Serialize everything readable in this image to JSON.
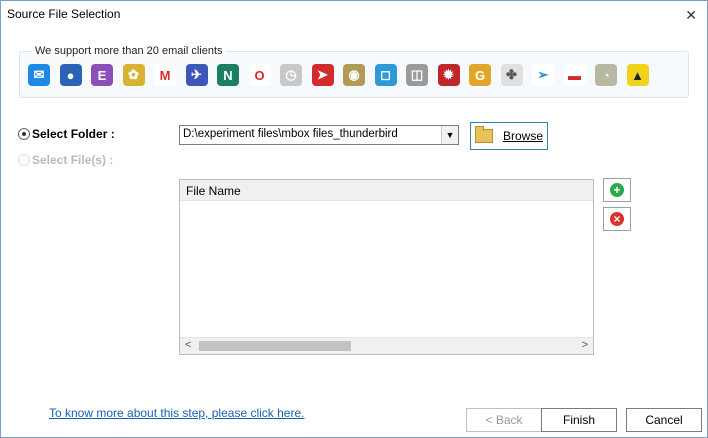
{
  "window": {
    "title": "Source File Selection",
    "close_glyph": "✕"
  },
  "clients": {
    "label": "We support more than 20 email clients",
    "icons": [
      {
        "name": "outlook-icon",
        "bg": "#1e88e5",
        "glyph": "✉"
      },
      {
        "name": "thunderbird-icon",
        "bg": "#2a63b5",
        "glyph": "●"
      },
      {
        "name": "entourage-icon",
        "bg": "#8b4fb8",
        "glyph": "E"
      },
      {
        "name": "eudora-icon",
        "bg": "#d8b232",
        "glyph": "✿"
      },
      {
        "name": "gmail-icon",
        "bg": "#ffffff",
        "glyph": "M",
        "fg": "#d93025"
      },
      {
        "name": "postbox-icon",
        "bg": "#3b57b8",
        "glyph": "✈"
      },
      {
        "name": "netscape-icon",
        "bg": "#1a7f64",
        "glyph": "N"
      },
      {
        "name": "opera-icon",
        "bg": "#ffffff",
        "glyph": "O",
        "fg": "#e3262f"
      },
      {
        "name": "apple-mail-icon",
        "bg": "#c8c8c8",
        "glyph": "◷"
      },
      {
        "name": "powermail-icon",
        "bg": "#d12b2b",
        "glyph": "➤"
      },
      {
        "name": "seamonkey-icon",
        "bg": "#b09a55",
        "glyph": "◉"
      },
      {
        "name": "spicebird-icon",
        "bg": "#2d9ad8",
        "glyph": "◻"
      },
      {
        "name": "sylpheed-icon",
        "bg": "#9a9a9a",
        "glyph": "◫"
      },
      {
        "name": "mulberry-icon",
        "bg": "#c0272d",
        "glyph": "✹"
      },
      {
        "name": "gyazmail-icon",
        "bg": "#e1a52a",
        "glyph": "G"
      },
      {
        "name": "claws-mail-icon",
        "bg": "#e0e0e0",
        "glyph": "✤",
        "fg": "#555"
      },
      {
        "name": "sparrow-icon",
        "bg": "#ffffff",
        "glyph": "➢",
        "fg": "#2a8cd8"
      },
      {
        "name": "mail-envelope-icon",
        "bg": "#ffffff",
        "glyph": "▬",
        "fg": "#d12b2b"
      },
      {
        "name": "evolution-icon",
        "bg": "#b7b7a2",
        "glyph": "◔"
      },
      {
        "name": "the-bat-icon",
        "bg": "#f1d31c",
        "glyph": "▲",
        "fg": "#222"
      }
    ]
  },
  "form": {
    "select_folder_label": "Select Folder :",
    "select_files_label": "Select File(s) :",
    "folder_path": "D:\\experiment files\\mbox files_thunderbird",
    "browse_label": "Browse"
  },
  "grid": {
    "column": "File Name",
    "scroll_left": "<",
    "scroll_right": ">"
  },
  "side_buttons": {
    "add_glyph": "+",
    "remove_glyph": "×"
  },
  "footer": {
    "help_link": "To know more about this step, please click here.",
    "back_label": "< Back",
    "finish_label": "Finish",
    "cancel_label": "Cancel"
  }
}
